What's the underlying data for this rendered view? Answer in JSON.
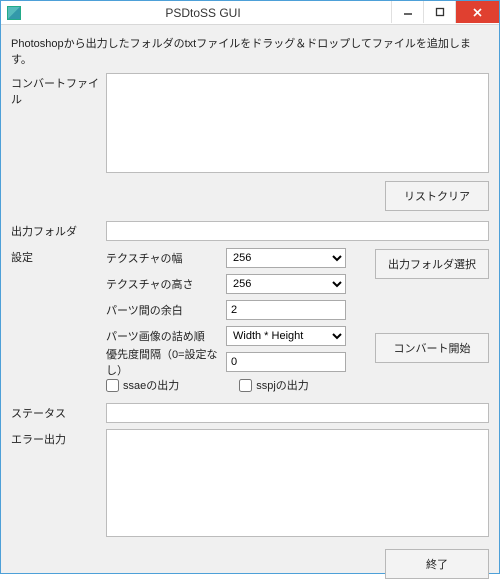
{
  "window": {
    "title": "PSDtoSS GUI"
  },
  "instruction": "Photoshopから出力したフォルダのtxtファイルをドラッグ＆ドロップしてファイルを追加します。",
  "labels": {
    "convert_file": "コンバートファイル",
    "output_folder": "出力フォルダ",
    "settings": "設定",
    "status": "ステータス",
    "error_output": "エラー出力"
  },
  "buttons": {
    "list_clear": "リストクリア",
    "choose_output_folder": "出力フォルダ選択",
    "convert_start": "コンバート開始",
    "exit": "終了"
  },
  "settings": {
    "tex_width_label": "テクスチャの幅",
    "tex_width_value": "256",
    "tex_height_label": "テクスチャの高さ",
    "tex_height_value": "256",
    "parts_margin_label": "パーツ間の余白",
    "parts_margin_value": "2",
    "parts_pack_order_label": "パーツ画像の詰め順",
    "parts_pack_order_value": "Width * Height",
    "priority_gap_label": "優先度間隔（0=設定なし）",
    "priority_gap_value": "0",
    "ssae_output_label": "ssaeの出力",
    "sspj_output_label": "sspjの出力"
  },
  "values": {
    "convert_file_list": "",
    "output_folder": "",
    "status": "",
    "error_output": ""
  }
}
